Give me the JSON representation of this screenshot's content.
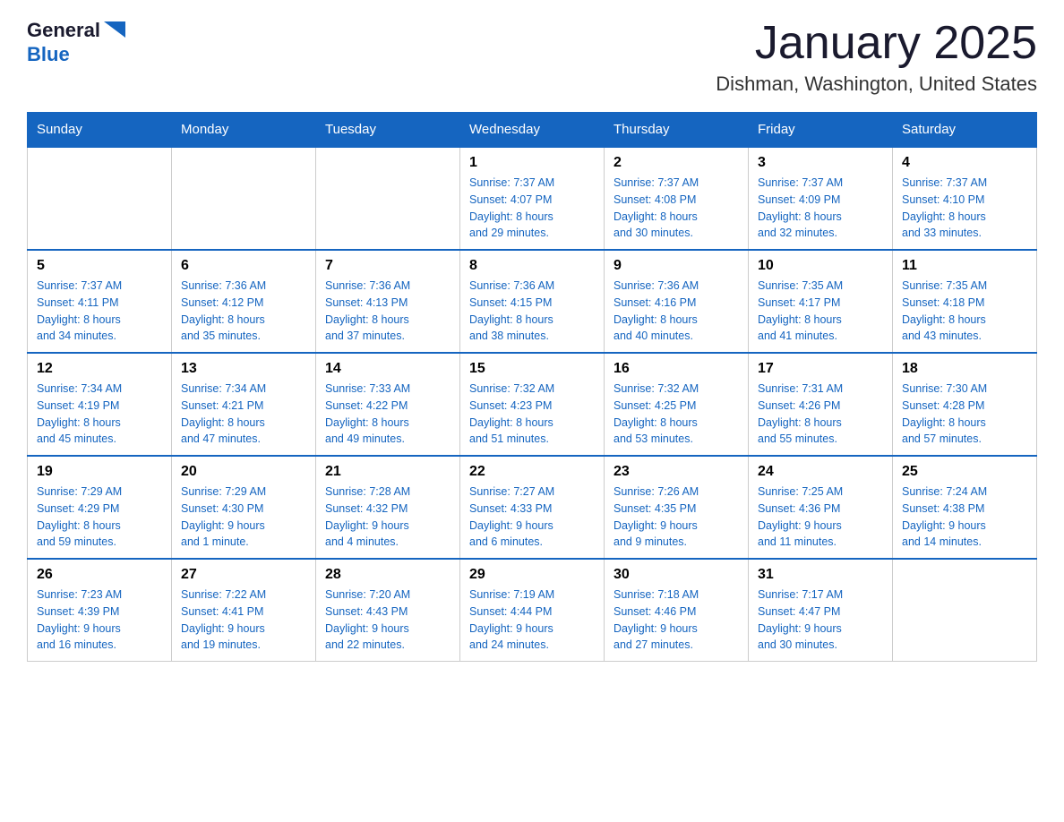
{
  "header": {
    "logo_general": "General",
    "logo_blue": "Blue",
    "month_title": "January 2025",
    "location": "Dishman, Washington, United States"
  },
  "weekdays": [
    "Sunday",
    "Monday",
    "Tuesday",
    "Wednesday",
    "Thursday",
    "Friday",
    "Saturday"
  ],
  "weeks": [
    [
      {
        "day": "",
        "info": ""
      },
      {
        "day": "",
        "info": ""
      },
      {
        "day": "",
        "info": ""
      },
      {
        "day": "1",
        "info": "Sunrise: 7:37 AM\nSunset: 4:07 PM\nDaylight: 8 hours\nand 29 minutes."
      },
      {
        "day": "2",
        "info": "Sunrise: 7:37 AM\nSunset: 4:08 PM\nDaylight: 8 hours\nand 30 minutes."
      },
      {
        "day": "3",
        "info": "Sunrise: 7:37 AM\nSunset: 4:09 PM\nDaylight: 8 hours\nand 32 minutes."
      },
      {
        "day": "4",
        "info": "Sunrise: 7:37 AM\nSunset: 4:10 PM\nDaylight: 8 hours\nand 33 minutes."
      }
    ],
    [
      {
        "day": "5",
        "info": "Sunrise: 7:37 AM\nSunset: 4:11 PM\nDaylight: 8 hours\nand 34 minutes."
      },
      {
        "day": "6",
        "info": "Sunrise: 7:36 AM\nSunset: 4:12 PM\nDaylight: 8 hours\nand 35 minutes."
      },
      {
        "day": "7",
        "info": "Sunrise: 7:36 AM\nSunset: 4:13 PM\nDaylight: 8 hours\nand 37 minutes."
      },
      {
        "day": "8",
        "info": "Sunrise: 7:36 AM\nSunset: 4:15 PM\nDaylight: 8 hours\nand 38 minutes."
      },
      {
        "day": "9",
        "info": "Sunrise: 7:36 AM\nSunset: 4:16 PM\nDaylight: 8 hours\nand 40 minutes."
      },
      {
        "day": "10",
        "info": "Sunrise: 7:35 AM\nSunset: 4:17 PM\nDaylight: 8 hours\nand 41 minutes."
      },
      {
        "day": "11",
        "info": "Sunrise: 7:35 AM\nSunset: 4:18 PM\nDaylight: 8 hours\nand 43 minutes."
      }
    ],
    [
      {
        "day": "12",
        "info": "Sunrise: 7:34 AM\nSunset: 4:19 PM\nDaylight: 8 hours\nand 45 minutes."
      },
      {
        "day": "13",
        "info": "Sunrise: 7:34 AM\nSunset: 4:21 PM\nDaylight: 8 hours\nand 47 minutes."
      },
      {
        "day": "14",
        "info": "Sunrise: 7:33 AM\nSunset: 4:22 PM\nDaylight: 8 hours\nand 49 minutes."
      },
      {
        "day": "15",
        "info": "Sunrise: 7:32 AM\nSunset: 4:23 PM\nDaylight: 8 hours\nand 51 minutes."
      },
      {
        "day": "16",
        "info": "Sunrise: 7:32 AM\nSunset: 4:25 PM\nDaylight: 8 hours\nand 53 minutes."
      },
      {
        "day": "17",
        "info": "Sunrise: 7:31 AM\nSunset: 4:26 PM\nDaylight: 8 hours\nand 55 minutes."
      },
      {
        "day": "18",
        "info": "Sunrise: 7:30 AM\nSunset: 4:28 PM\nDaylight: 8 hours\nand 57 minutes."
      }
    ],
    [
      {
        "day": "19",
        "info": "Sunrise: 7:29 AM\nSunset: 4:29 PM\nDaylight: 8 hours\nand 59 minutes."
      },
      {
        "day": "20",
        "info": "Sunrise: 7:29 AM\nSunset: 4:30 PM\nDaylight: 9 hours\nand 1 minute."
      },
      {
        "day": "21",
        "info": "Sunrise: 7:28 AM\nSunset: 4:32 PM\nDaylight: 9 hours\nand 4 minutes."
      },
      {
        "day": "22",
        "info": "Sunrise: 7:27 AM\nSunset: 4:33 PM\nDaylight: 9 hours\nand 6 minutes."
      },
      {
        "day": "23",
        "info": "Sunrise: 7:26 AM\nSunset: 4:35 PM\nDaylight: 9 hours\nand 9 minutes."
      },
      {
        "day": "24",
        "info": "Sunrise: 7:25 AM\nSunset: 4:36 PM\nDaylight: 9 hours\nand 11 minutes."
      },
      {
        "day": "25",
        "info": "Sunrise: 7:24 AM\nSunset: 4:38 PM\nDaylight: 9 hours\nand 14 minutes."
      }
    ],
    [
      {
        "day": "26",
        "info": "Sunrise: 7:23 AM\nSunset: 4:39 PM\nDaylight: 9 hours\nand 16 minutes."
      },
      {
        "day": "27",
        "info": "Sunrise: 7:22 AM\nSunset: 4:41 PM\nDaylight: 9 hours\nand 19 minutes."
      },
      {
        "day": "28",
        "info": "Sunrise: 7:20 AM\nSunset: 4:43 PM\nDaylight: 9 hours\nand 22 minutes."
      },
      {
        "day": "29",
        "info": "Sunrise: 7:19 AM\nSunset: 4:44 PM\nDaylight: 9 hours\nand 24 minutes."
      },
      {
        "day": "30",
        "info": "Sunrise: 7:18 AM\nSunset: 4:46 PM\nDaylight: 9 hours\nand 27 minutes."
      },
      {
        "day": "31",
        "info": "Sunrise: 7:17 AM\nSunset: 4:47 PM\nDaylight: 9 hours\nand 30 minutes."
      },
      {
        "day": "",
        "info": ""
      }
    ]
  ]
}
